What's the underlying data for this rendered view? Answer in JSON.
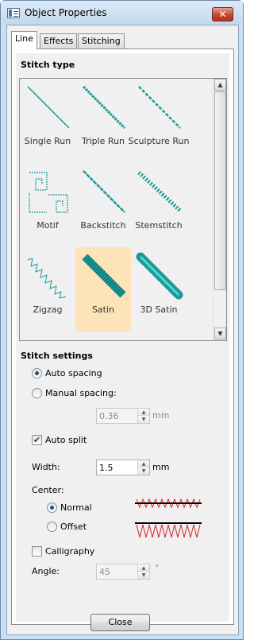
{
  "window": {
    "title": "Object Properties",
    "close_glyph": "✕"
  },
  "tabs": [
    {
      "label": "Line",
      "active": true
    },
    {
      "label": "Effects",
      "active": false
    },
    {
      "label": "Stitching",
      "active": false
    }
  ],
  "stitch_type": {
    "heading": "Stitch type",
    "items": [
      {
        "label": "Single Run",
        "icon": "single-run-icon"
      },
      {
        "label": "Triple Run",
        "icon": "triple-run-icon"
      },
      {
        "label": "Sculpture Run",
        "icon": "sculpture-run-icon"
      },
      {
        "label": "Motif",
        "icon": "motif-icon"
      },
      {
        "label": "Backstitch",
        "icon": "backstitch-icon"
      },
      {
        "label": "Stemstitch",
        "icon": "stemstitch-icon"
      },
      {
        "label": "Zigzag",
        "icon": "zigzag-icon"
      },
      {
        "label": "Satin",
        "icon": "satin-icon",
        "selected": true
      },
      {
        "label": "3D Satin",
        "icon": "3d-satin-icon"
      }
    ],
    "scroll": {
      "up": "▲",
      "down": "▼"
    }
  },
  "stitch_settings": {
    "heading": "Stitch settings",
    "auto_spacing": {
      "label": "Auto spacing",
      "checked": true
    },
    "manual_spacing": {
      "label": "Manual spacing:",
      "checked": false,
      "value": "0.36",
      "unit": "mm"
    },
    "auto_split": {
      "label": "Auto split",
      "checked": true,
      "mark": "✔"
    },
    "width": {
      "label": "Width:",
      "value": "1.5",
      "unit": "mm"
    },
    "center": {
      "label": "Center:",
      "normal": "Normal",
      "offset": "Offset",
      "selected": "Normal"
    },
    "calligraphy": {
      "label": "Calligraphy",
      "checked": false
    },
    "angle": {
      "label": "Angle:",
      "value": "45",
      "unit": "°"
    }
  },
  "footer": {
    "close_label": "Close"
  },
  "colors": {
    "accent_selected": "#fde3b8",
    "stitch": "#1a9a9a",
    "preview": "#d2232a"
  }
}
